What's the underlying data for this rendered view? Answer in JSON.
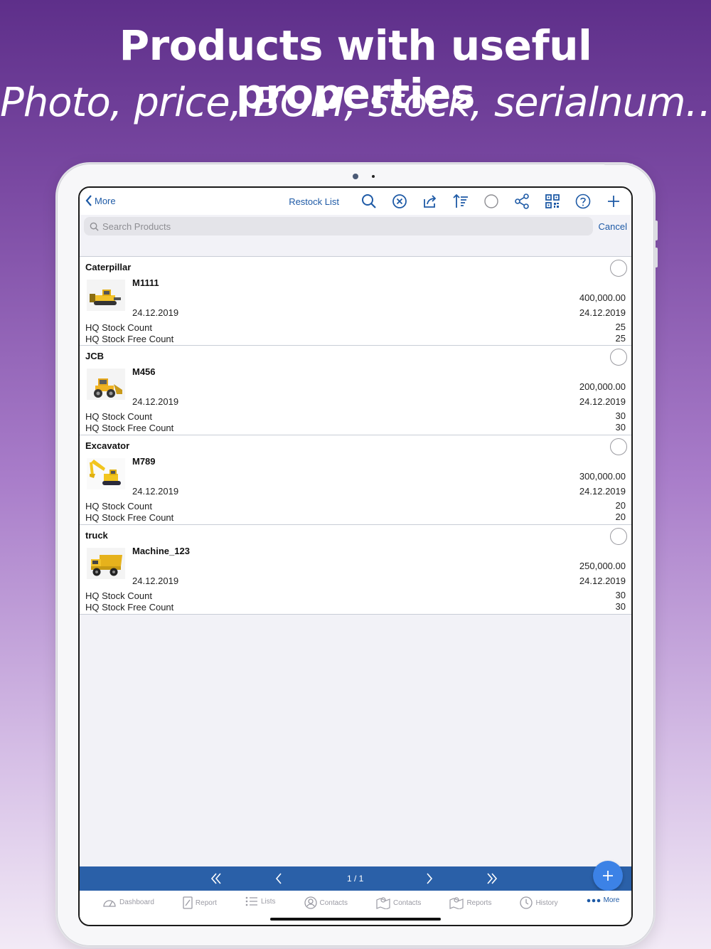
{
  "headline": "Products with useful properties",
  "subline": "Photo, price, BOM, stock, serialnum…",
  "navbar": {
    "back_label": "More",
    "restock_label": "Restock List",
    "icons": [
      "search-icon",
      "clear-circle-icon",
      "share-out-icon",
      "sort-icon",
      "select-circle-icon",
      "network-share-icon",
      "qr-code-icon",
      "help-icon",
      "add-icon"
    ]
  },
  "search": {
    "placeholder": "Search Products",
    "cancel_label": "Cancel"
  },
  "products": [
    {
      "name": "Caterpillar",
      "code": "M1111",
      "date": "24.12.2019",
      "price": "400,000.00",
      "price_date": "24.12.2019",
      "stock_label": "HQ Stock Count",
      "stock_value": "25",
      "free_label": "HQ Stock Free Count",
      "free_value": "25"
    },
    {
      "name": "JCB",
      "code": "M456",
      "date": "24.12.2019",
      "price": "200,000.00",
      "price_date": "24.12.2019",
      "stock_label": "HQ Stock Count",
      "stock_value": "30",
      "free_label": "HQ Stock Free Count",
      "free_value": "30"
    },
    {
      "name": "Excavator",
      "code": "M789",
      "date": "24.12.2019",
      "price": "300,000.00",
      "price_date": "24.12.2019",
      "stock_label": "HQ Stock Count",
      "stock_value": "20",
      "free_label": "HQ Stock Free Count",
      "free_value": "20"
    },
    {
      "name": "truck",
      "code": "Machine_123",
      "date": "24.12.2019",
      "price": "250,000.00",
      "price_date": "24.12.2019",
      "stock_label": "HQ Stock Count",
      "stock_value": "30",
      "free_label": "HQ Stock Free Count",
      "free_value": "30"
    }
  ],
  "pager": {
    "label": "1 / 1"
  },
  "tabs": [
    {
      "label": "Dashboard",
      "icon": "dashboard-icon"
    },
    {
      "label": "Report",
      "icon": "report-icon"
    },
    {
      "label": "Lists",
      "icon": "list-icon"
    },
    {
      "label": "Contacts",
      "icon": "contact-icon"
    },
    {
      "label": "Contacts",
      "icon": "map-icon"
    },
    {
      "label": "Reports",
      "icon": "map-icon"
    },
    {
      "label": "History",
      "icon": "clock-icon"
    },
    {
      "label": "More",
      "icon": "more-dots-icon"
    }
  ],
  "colors": {
    "accent": "#1e5aa6",
    "pager_bar": "#2a60a8",
    "fab": "#3c82e6"
  }
}
